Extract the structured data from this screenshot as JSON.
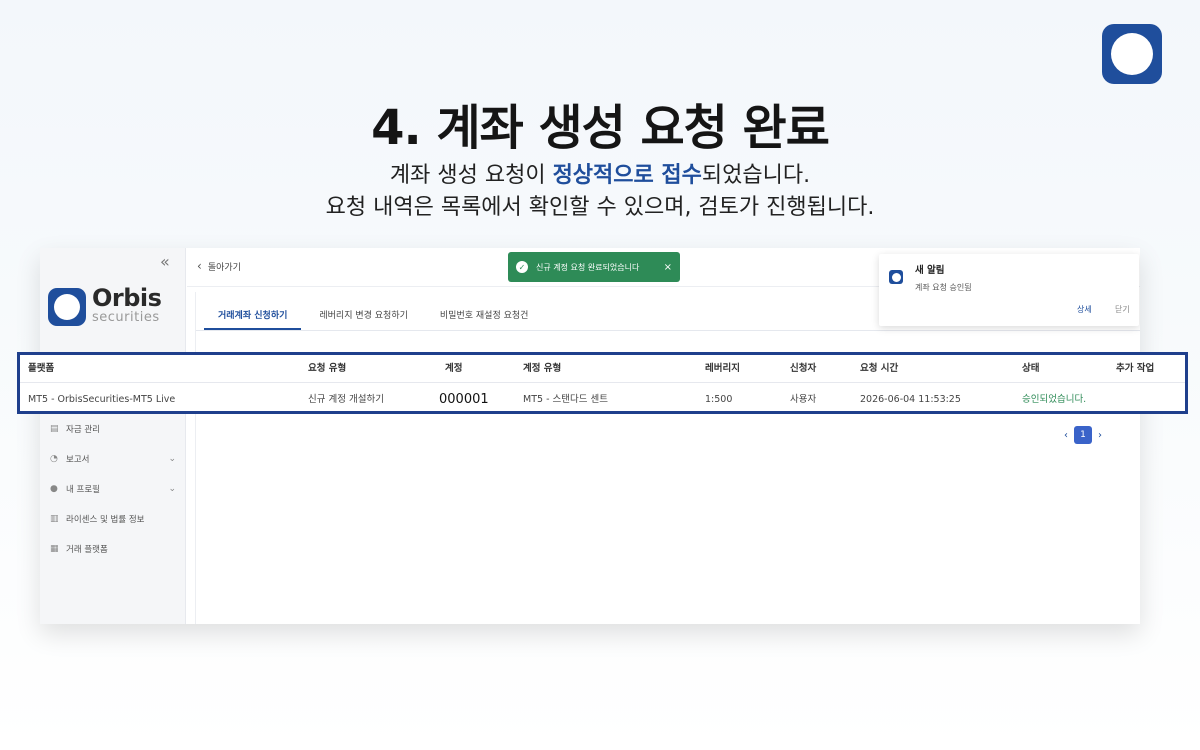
{
  "slide": {
    "heading": "4. 계좌 생성 요청 완료",
    "subtitle_line1_pre": "계좌 생성 요청이 ",
    "subtitle_line1_hl": "정상적으로 접수",
    "subtitle_line1_post": "되었습니다.",
    "subtitle_line2": "요청 내역은 목록에서 확인할 수 있으며, 검토가 진행됩니다."
  },
  "brand": {
    "name": "Orbis",
    "sub": "securities"
  },
  "sidebar": {
    "collapse_icon": "«",
    "items": [
      {
        "label": "자금 관리",
        "icon": "wallet-icon",
        "has_chevron": false
      },
      {
        "label": "보고서",
        "icon": "report-icon",
        "has_chevron": true
      },
      {
        "label": "내 프로필",
        "icon": "user-icon",
        "has_chevron": true
      },
      {
        "label": "라이센스 및 법률 정보",
        "icon": "document-icon",
        "has_chevron": false
      },
      {
        "label": "거래 플랫폼",
        "icon": "platform-icon",
        "has_chevron": false
      }
    ]
  },
  "topbar": {
    "back_label": "돌아가기"
  },
  "toast": {
    "message": "신규 계정 요청 완료되었습니다",
    "close": "×"
  },
  "tabs": [
    {
      "label": "거래계좌 신청하기",
      "active": true
    },
    {
      "label": "레버리지 변경 요청하기",
      "active": false
    },
    {
      "label": "비밀번호 재설정 요청건",
      "active": false
    }
  ],
  "notification": {
    "title": "새 알림",
    "body": "계좌 요청 승인됨",
    "detail_label": "상세",
    "close_label": "닫기"
  },
  "table": {
    "headers": [
      "플랫폼",
      "요청 유형",
      "계정",
      "계정 유형",
      "레버리지",
      "신청자",
      "요청 시간",
      "상태",
      "추가 작업"
    ],
    "rows": [
      [
        "MT5 - OrbisSecurities-MT5 Live",
        "신규 계정 개설하기",
        "000001",
        "MT5 - 스탠다드 센트",
        "1:500",
        "사용자",
        "2026-06-04 11:53:25",
        "승인되었습니다.",
        ""
      ]
    ]
  },
  "pagination": {
    "prev": "‹",
    "current": "1",
    "next": "›"
  },
  "colors": {
    "brand": "#1f4e9c",
    "success": "#2e8b57",
    "highlight_border": "#1f3f8c"
  }
}
